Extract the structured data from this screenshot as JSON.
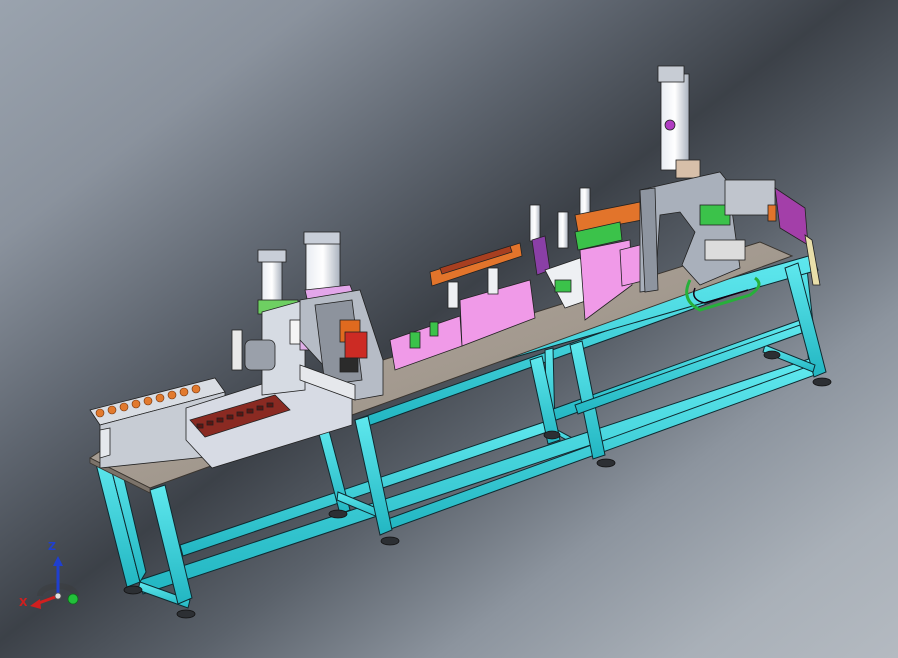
{
  "viewport": {
    "title": "",
    "background_colors": [
      "#9aa3ae",
      "#3c4148",
      "#b4bac1"
    ]
  },
  "model": {
    "frame_color": "#36d6e0",
    "plate_color": "#a49a8f",
    "pink_color": "#f09ae8",
    "orange_color": "#e2742b",
    "green_color": "#3bc24a",
    "purple_color": "#a33fa9",
    "frame_stroke": "#0e2a30"
  },
  "triad": {
    "z_label": "Z",
    "x_label": "X",
    "z_color": "#1f3fd0",
    "x_color": "#d01f1f",
    "y_color": "#22c03a",
    "icon": "axis-triad-icon"
  }
}
